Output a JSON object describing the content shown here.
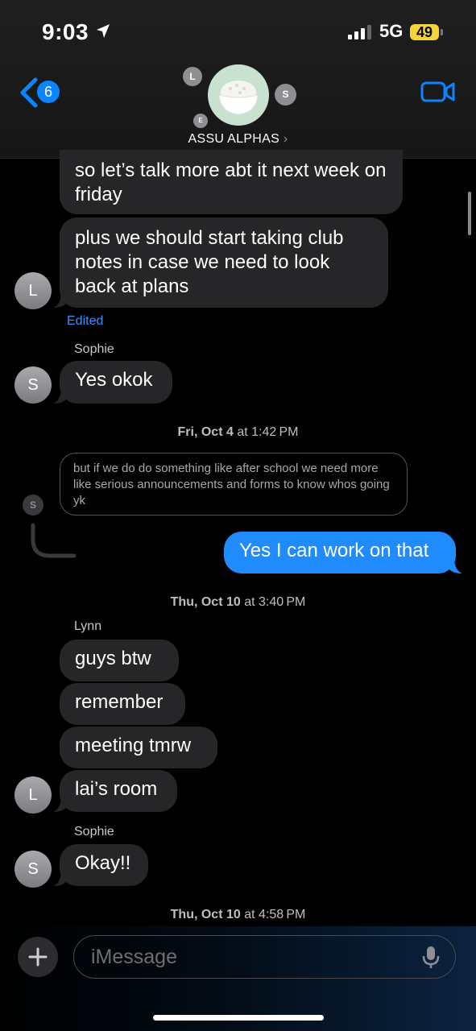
{
  "status_bar": {
    "time": "9:03",
    "network": "5G",
    "battery": "49"
  },
  "header": {
    "back_count": "6",
    "group_name": "ASSU ALPHAS",
    "member_initials": [
      "L",
      "S",
      "E"
    ]
  },
  "messages": {
    "m1": "so let’s talk more abt it next week on friday",
    "m2": "plus we should start taking club notes in case we need to look back at plans",
    "edited": "Edited",
    "sender_sophie_1": "Sophie",
    "m3": "Yes okok",
    "ts1_day": "Fri, Oct 4",
    "ts1_time": "at 1:42 PM",
    "reply_quote": "but if we do do something like after school we need more like serious announcements and forms to know whos going yk",
    "reply_avatar": "S",
    "m4": "Yes I can work on that",
    "ts2_day": "Thu, Oct 10",
    "ts2_time": "at 3:40 PM",
    "sender_lynn": "Lynn",
    "m5": "guys btw",
    "m6": "remember",
    "m7": "meeting tmrw",
    "m8": "lai’s room",
    "sender_sophie_2": "Sophie",
    "m9": "Okay!!",
    "ts3_day": "Thu, Oct 10",
    "ts3_time": "at 4:58 PM",
    "avatar_l": "L",
    "avatar_s": "S"
  },
  "input": {
    "placeholder": "iMessage"
  },
  "colors": {
    "accent": "#0a84ff",
    "outgoing_bubble": "#1f8bfd",
    "incoming_bubble": "#262629"
  }
}
